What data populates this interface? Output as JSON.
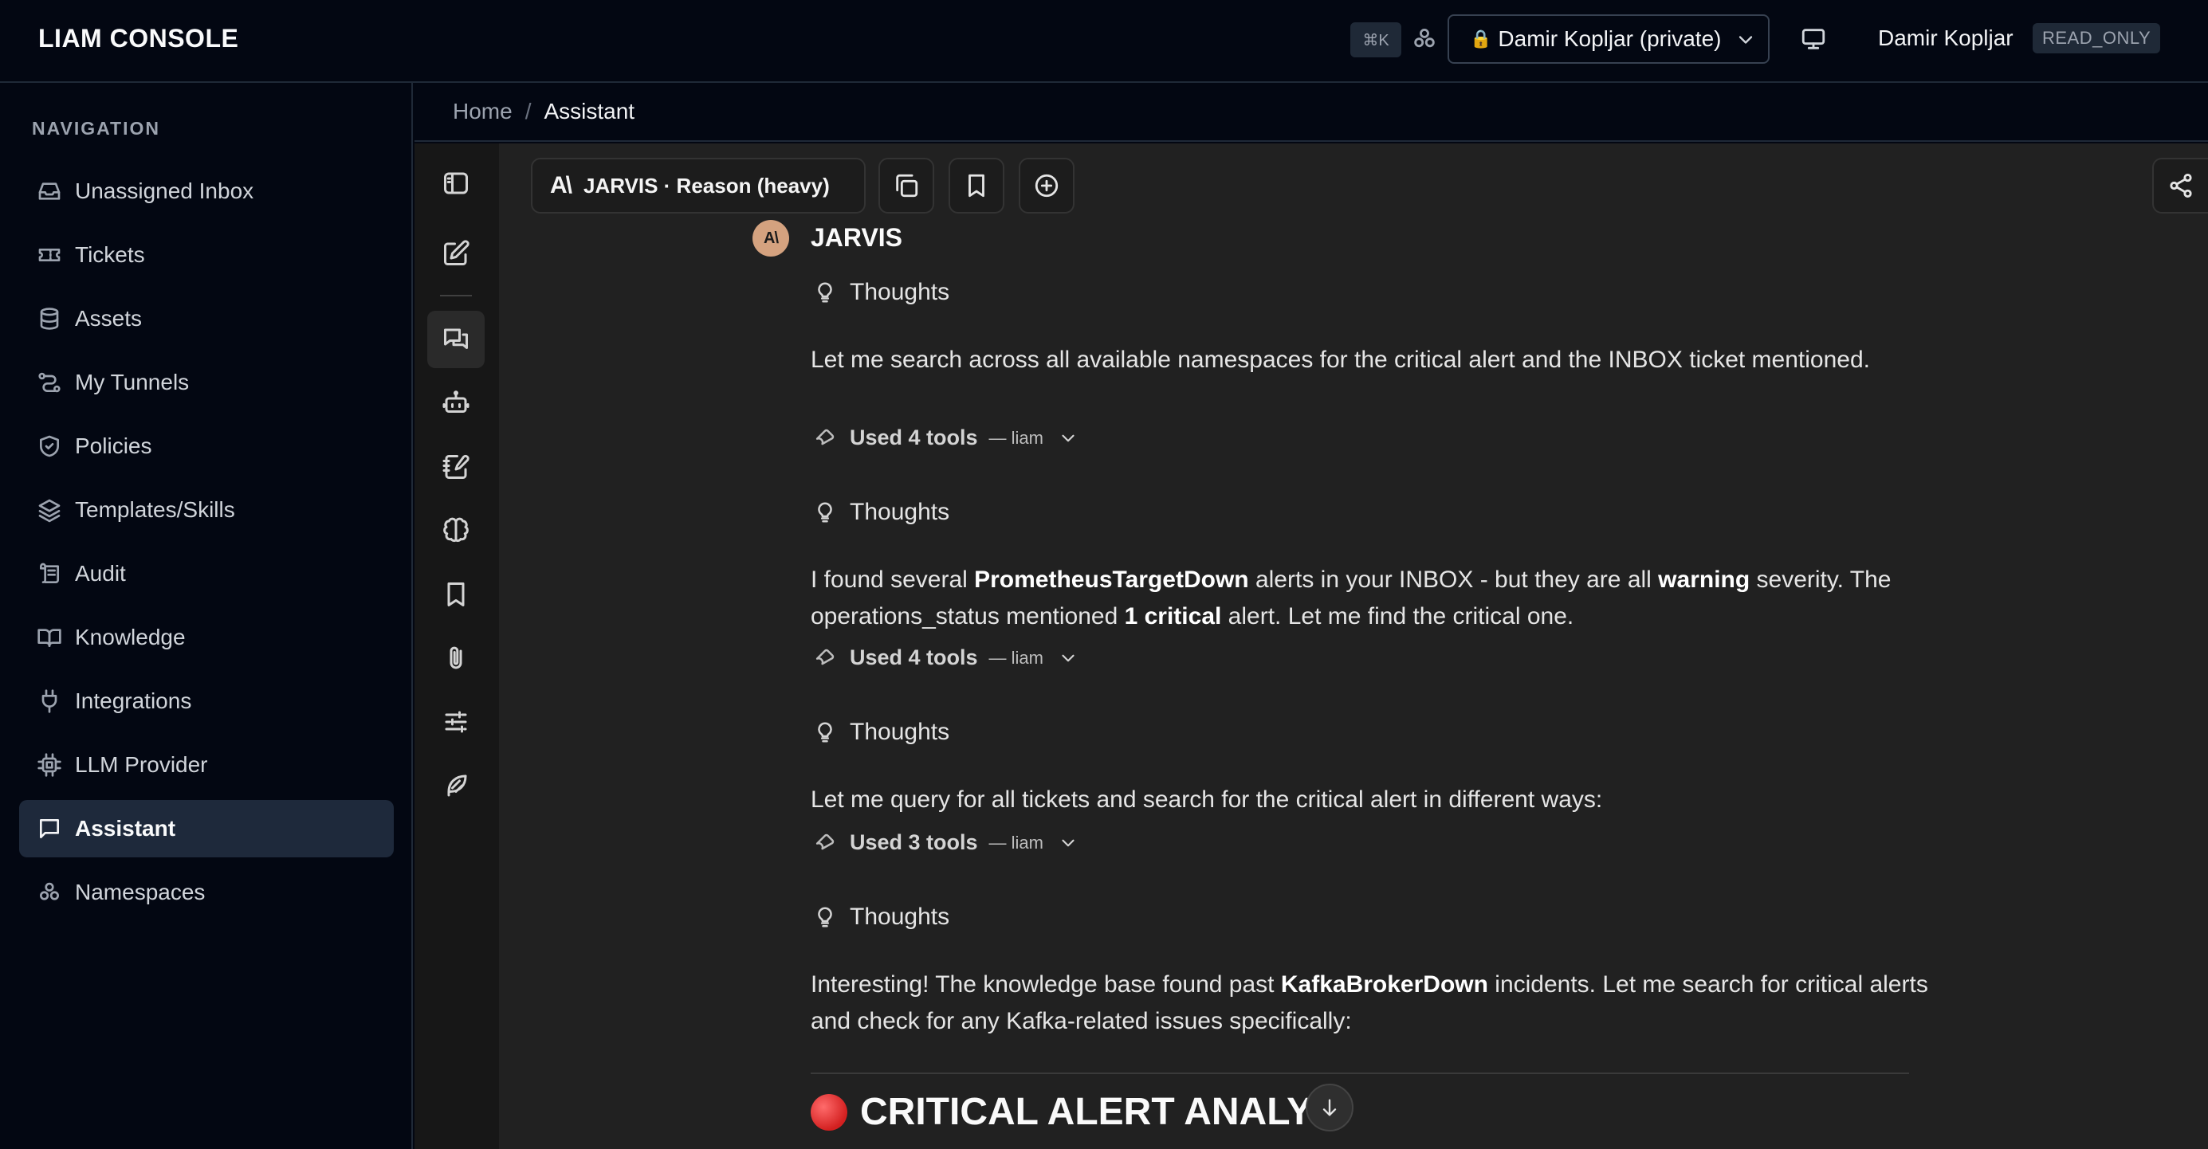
{
  "header": {
    "brand": "LIAM CONSOLE",
    "shortcut": "⌘K",
    "namespace_label": "Damir Kopljar (private)",
    "user_name": "Damir Kopljar",
    "user_role": "READ_ONLY",
    "icons": [
      "namespace-icon",
      "lock-icon",
      "chevron-down-icon",
      "monitor-icon"
    ]
  },
  "sidebar": {
    "title": "NAVIGATION",
    "items": [
      {
        "label": "Unassigned Inbox",
        "icon": "inbox-icon"
      },
      {
        "label": "Tickets",
        "icon": "ticket-icon"
      },
      {
        "label": "Assets",
        "icon": "database-icon"
      },
      {
        "label": "My Tunnels",
        "icon": "tunnel-icon"
      },
      {
        "label": "Policies",
        "icon": "shield-icon"
      },
      {
        "label": "Templates/Skills",
        "icon": "layers-icon"
      },
      {
        "label": "Audit",
        "icon": "scroll-icon"
      },
      {
        "label": "Knowledge",
        "icon": "book-icon"
      },
      {
        "label": "Integrations",
        "icon": "plug-icon"
      },
      {
        "label": "LLM Provider",
        "icon": "chip-icon"
      },
      {
        "label": "Assistant",
        "icon": "chat-icon",
        "active": true
      },
      {
        "label": "Namespaces",
        "icon": "namespace-icon"
      }
    ]
  },
  "breadcrumb": {
    "home": "Home",
    "separator": "/",
    "current": "Assistant"
  },
  "toolbar": {
    "model_label": "JARVIS · Reason (heavy)",
    "model_logo": "A\\"
  },
  "message": {
    "author": "JARVIS",
    "avatar_text": "A\\",
    "blocks": [
      {
        "thoughts_label": "Thoughts",
        "text": "Let me search across all available namespaces for the critical alert and the INBOX ticket mentioned.",
        "tools_label": "Used 4 tools",
        "tools_source": "— liam"
      },
      {
        "thoughts_label": "Thoughts",
        "text_parts": [
          "I found several ",
          "PrometheusTargetDown",
          " alerts in your INBOX - but they are all ",
          "warning",
          " severity. The operations_status mentioned ",
          "1 critical",
          " alert. Let me find the critical one."
        ],
        "tools_label": "Used 4 tools",
        "tools_source": "— liam"
      },
      {
        "thoughts_label": "Thoughts",
        "text": "Let me query for all tickets and search for the critical alert in different ways:",
        "tools_label": "Used 3 tools",
        "tools_source": "— liam"
      },
      {
        "thoughts_label": "Thoughts",
        "text_parts": [
          "Interesting! The knowledge base found past ",
          "KafkaBrokerDown",
          " incidents. Let me search for critical alerts and check for any Kafka-related issues specifically:"
        ]
      }
    ],
    "heading": "CRITICAL ALERT ANALYS"
  },
  "colors": {
    "background": "#030712",
    "chat_background": "#212121",
    "active_nav": "#1e293b",
    "avatar": "#d4a27f",
    "critical_dot": "#d32020"
  }
}
